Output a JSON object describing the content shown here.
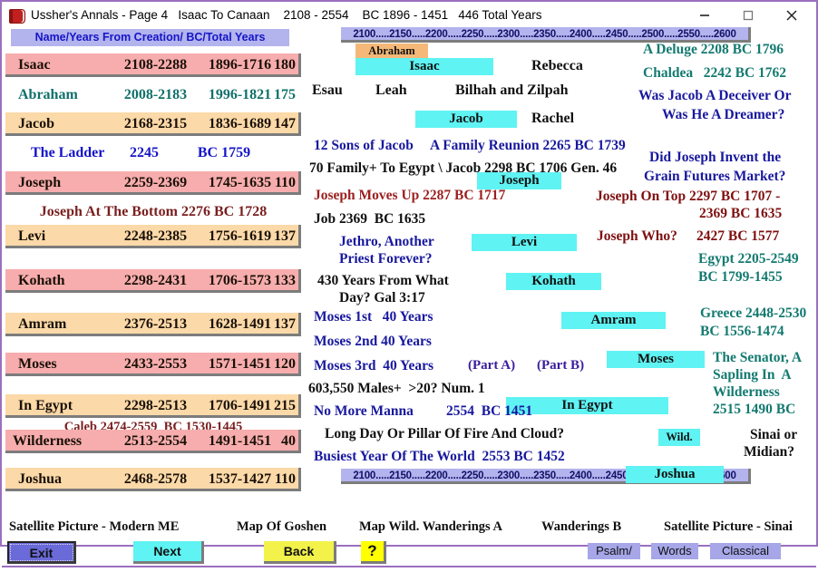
{
  "window": {
    "title": "Ussher's Annals - Page 4   Isaac To Canaan    2108 - 2554    BC 1896 - 1451   446 Total Years",
    "icon": "book-icon",
    "minimize_label": "minimize-icon",
    "maximize_label": "maximize-icon",
    "close_label": "close-icon",
    "border_color": "#9b6fbf"
  },
  "left_panel": {
    "header": "Name/Years From Creation/ BC/Total Years",
    "header_bg": "#b3b3ee",
    "header_color": "#1515c8",
    "rows": [
      {
        "name": "Isaac",
        "creation": "2108-2288",
        "bc": "1896-1716",
        "total": "180",
        "style": "pink"
      },
      {
        "name": "Abraham",
        "creation": "2008-2183",
        "bc": "1996-1821",
        "total": "175",
        "style": "white-teal"
      },
      {
        "name": "Jacob",
        "creation": "2168-2315",
        "bc": "1836-1689",
        "total": "147",
        "style": "peach"
      },
      {
        "name": "The Ladder",
        "creation": "2245",
        "bc": "BC 1759",
        "total": "",
        "style": "white-blue"
      },
      {
        "name": "Joseph",
        "creation": "2259-2369",
        "bc": "1745-1635",
        "total": "110",
        "style": "pink"
      },
      {
        "note": "Joseph At The Bottom 2276 BC 1728",
        "style": "note-maroon"
      },
      {
        "name": "Levi",
        "creation": "2248-2385",
        "bc": "1756-1619",
        "total": "137",
        "style": "peach"
      },
      {
        "name": "Kohath",
        "creation": "2298-2431",
        "bc": "1706-1573",
        "total": "133",
        "style": "pink"
      },
      {
        "name": "Amram",
        "creation": "2376-2513",
        "bc": "1628-1491",
        "total": "137",
        "style": "peach"
      },
      {
        "name": "Moses",
        "creation": "2433-2553",
        "bc": "1571-1451",
        "total": "120",
        "style": "pink"
      },
      {
        "name": "In Egypt",
        "creation": "2298-2513",
        "bc": "1706-1491",
        "total": "215",
        "style": "peach"
      },
      {
        "name": "Wilderness",
        "creation": "2513-2554",
        "bc": "1491-1451",
        "total": "40",
        "style": "pink"
      },
      {
        "name": "Joshua",
        "creation": "2468-2578",
        "bc": "1537-1427",
        "total": "110",
        "style": "peach"
      }
    ],
    "caleb_note": "Caleb 2474-2559  BC 1530-1445"
  },
  "timeline": {
    "ruler_top": "2100.....2150.....2200.....2250.....2300.....2350.....2400.....2450.....2500.....2550.....2600",
    "ruler_bottom": "2100.....2150.....2200.....2250.....2300.....2350.....2400.....2450.....2500.....2550.....2600",
    "bars": [
      {
        "label": "Abraham",
        "color": "#f5b878"
      },
      {
        "label": "Isaac",
        "color": "#5ff3f3"
      },
      {
        "label": "Jacob",
        "color": "#5ff3f3"
      },
      {
        "label": "Joseph",
        "color": "#5ff3f3"
      },
      {
        "label": "Levi",
        "color": "#5ff3f3"
      },
      {
        "label": "Kohath",
        "color": "#5ff3f3"
      },
      {
        "label": "Amram",
        "color": "#5ff3f3"
      },
      {
        "label": "Moses",
        "color": "#5ff3f3"
      },
      {
        "label": "In Egypt",
        "color": "#5ff3f3"
      },
      {
        "label": "Wild.",
        "color": "#5ff3f3"
      },
      {
        "label": "Joshua",
        "color": "#5ff3f3"
      }
    ]
  },
  "middle": {
    "rebecca": "Rebecca",
    "esau": "Esau",
    "leah": "Leah",
    "bilhah_zilpah": "Bilhah and Zilpah",
    "rachel": "Rachel",
    "twelve_sons": "12 Sons of Jacob",
    "family_reunion": "A Family Reunion 2265 BC 1739",
    "to_egypt": "70 Family+ To Egypt \\ Jacob 2298 BC 1706 Gen. 46",
    "joseph_moves_up": "Joseph Moves Up 2287 BC 1717",
    "job": "Job 2369  BC 1635",
    "jethro_1": "Jethro, Another",
    "jethro_2": "Priest Forever?",
    "four_thirty_1": "430 Years From What",
    "four_thirty_2": "Day? Gal 3:17",
    "moses_1st": "Moses 1st   40 Years",
    "moses_2nd": "Moses 2nd 40 Years",
    "moses_3rd": "Moses 3rd  40 Years",
    "part_a": "(Part A)",
    "part_b": "(Part B)",
    "males": "603,550 Males+  >20? Num. 1",
    "no_more_manna": "No More Manna",
    "no_more_manna_date": "2554  BC 1451",
    "long_day": "Long Day Or Pillar Of Fire And Cloud?",
    "busiest_year": "Busiest Year Of The World  2553 BC 1452"
  },
  "right": {
    "deluge": "A Deluge 2208 BC 1796",
    "chaldea": "Chaldea   2242 BC 1762",
    "jacob_q_1": "Was Jacob A Deceiver Or",
    "jacob_q_2": "Was He A Dreamer?",
    "grain_q_1": "Did Joseph Invent the",
    "grain_q_2": "Grain Futures Market?",
    "joseph_top_1": "Joseph On Top 2297 BC 1707 -",
    "joseph_top_2": "2369 BC 1635",
    "joseph_who": "Joseph Who?",
    "joseph_who_date": "2427 BC 1577",
    "egypt_1": "Egypt 2205-2549",
    "egypt_2": "BC 1799-1455",
    "greece_1": "Greece 2448-2530",
    "greece_2": "BC 1556-1474",
    "senator_1": "The Senator, A",
    "senator_2": "Sapling In  A",
    "senator_3": "Wilderness",
    "senator_4": "2515 1490 BC",
    "sinai_1": "Sinai or",
    "sinai_2": "Midian?"
  },
  "bottom": {
    "labels": [
      "Satellite Picture - Modern ME",
      "Map Of Goshen",
      "Map Wild. Wanderings A",
      "Wanderings B",
      "Satellite Picture - Sinai"
    ],
    "buttons": [
      {
        "label": "Exit",
        "color": "#6a6ad8"
      },
      {
        "label": "Next",
        "color": "#5ff3f3"
      },
      {
        "label": "Back",
        "color": "#f2f24a"
      },
      {
        "label": "?",
        "color": "#ffff00"
      }
    ],
    "mini_links": [
      "Psalm/",
      "Words",
      "Classical"
    ]
  }
}
